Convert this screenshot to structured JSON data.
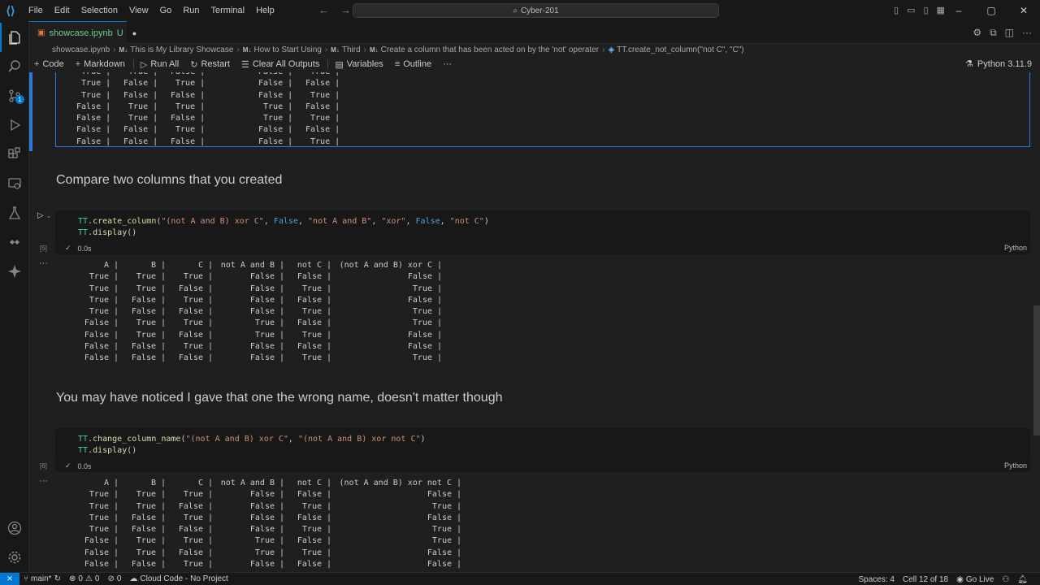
{
  "menu": [
    "File",
    "Edit",
    "Selection",
    "View",
    "Go",
    "Run",
    "Terminal",
    "Help"
  ],
  "search": {
    "text": "Cyber-201"
  },
  "tab": {
    "filename": "showcase.ipynb",
    "status": "U"
  },
  "breadcrumb": [
    {
      "label": "showcase.ipynb",
      "md": ""
    },
    {
      "label": "This is My Library Showcase",
      "md": "M↓"
    },
    {
      "label": "How to Start Using",
      "md": "M↓"
    },
    {
      "label": "Third",
      "md": "M↓"
    },
    {
      "label": "Create a column that has been acted on by the 'not' operater",
      "md": "M↓"
    },
    {
      "label": "TT.create_not_column(\"not C\", \"C\")",
      "md": ""
    }
  ],
  "toolbar": {
    "code": "Code",
    "markdown": "Markdown",
    "run_all": "Run All",
    "restart": "Restart",
    "clear_outputs": "Clear All Outputs",
    "variables": "Variables",
    "outline": "Outline",
    "more": "···",
    "kernel": "Python 3.11.9"
  },
  "output1": {
    "rows": [
      [
        "True",
        "True",
        "False",
        "False",
        "True"
      ],
      [
        "True",
        "False",
        "True",
        "False",
        "False"
      ],
      [
        "True",
        "False",
        "False",
        "False",
        "True"
      ],
      [
        "False",
        "True",
        "True",
        "True",
        "False"
      ],
      [
        "False",
        "True",
        "False",
        "True",
        "True"
      ],
      [
        "False",
        "False",
        "True",
        "False",
        "False"
      ],
      [
        "False",
        "False",
        "False",
        "False",
        "True"
      ]
    ]
  },
  "md1": "Compare two columns that you created",
  "cell5": {
    "exec_count": "[5]",
    "line1": {
      "obj": "TT",
      "fn": "create_column",
      "a1": "\"(not A and B) xor C\"",
      "a2": "False",
      "a3": "\"not A and B\"",
      "a4": "\"xor\"",
      "a5": "False",
      "a6": "\"not C\""
    },
    "line2": {
      "obj": "TT",
      "fn": "display"
    },
    "time": "0.0s",
    "lang": "Python"
  },
  "output2": {
    "headers": [
      "A",
      "B",
      "C",
      "not A and B",
      "not C",
      "(not A and B) xor C"
    ],
    "rows": [
      [
        "True",
        "True",
        "True",
        "False",
        "False",
        "False"
      ],
      [
        "True",
        "True",
        "False",
        "False",
        "True",
        "True"
      ],
      [
        "True",
        "False",
        "True",
        "False",
        "False",
        "False"
      ],
      [
        "True",
        "False",
        "False",
        "False",
        "True",
        "True"
      ],
      [
        "False",
        "True",
        "True",
        "True",
        "False",
        "True"
      ],
      [
        "False",
        "True",
        "False",
        "True",
        "True",
        "False"
      ],
      [
        "False",
        "False",
        "True",
        "False",
        "False",
        "False"
      ],
      [
        "False",
        "False",
        "False",
        "False",
        "True",
        "True"
      ]
    ]
  },
  "md2": "You may have noticed I gave that one the wrong name, doesn't matter though",
  "cell6": {
    "exec_count": "[6]",
    "line1": {
      "obj": "TT",
      "fn": "change_column_name",
      "a1": "\"(not A and B) xor C\"",
      "a2": "\"(not A and B) xor not C\""
    },
    "line2": {
      "obj": "TT",
      "fn": "display"
    },
    "time": "0.0s",
    "lang": "Python"
  },
  "output3": {
    "headers": [
      "A",
      "B",
      "C",
      "not A and B",
      "not C",
      "(not A and B) xor not C"
    ],
    "rows": [
      [
        "True",
        "True",
        "True",
        "False",
        "False",
        "False"
      ],
      [
        "True",
        "True",
        "False",
        "False",
        "True",
        "True"
      ],
      [
        "True",
        "False",
        "True",
        "False",
        "False",
        "False"
      ],
      [
        "True",
        "False",
        "False",
        "False",
        "True",
        "True"
      ],
      [
        "False",
        "True",
        "True",
        "True",
        "False",
        "True"
      ],
      [
        "False",
        "True",
        "False",
        "True",
        "True",
        "False"
      ],
      [
        "False",
        "False",
        "True",
        "False",
        "False",
        "False"
      ]
    ]
  },
  "statusbar": {
    "branch": "main*",
    "errors": "0",
    "warnings": "0",
    "ports": "0",
    "cloud": "Cloud Code - No Project",
    "spaces": "Spaces: 4",
    "cell": "Cell 12 of 18",
    "golive": "Go Live"
  },
  "activity_badges": {
    "scm": "1",
    "run": "1"
  },
  "colors": {
    "accent": "#0078d4",
    "string": "#ce9178",
    "keyword": "#569cd6",
    "object": "#4ec9b0",
    "function": "#dcdcaa",
    "success": "#89d185"
  }
}
